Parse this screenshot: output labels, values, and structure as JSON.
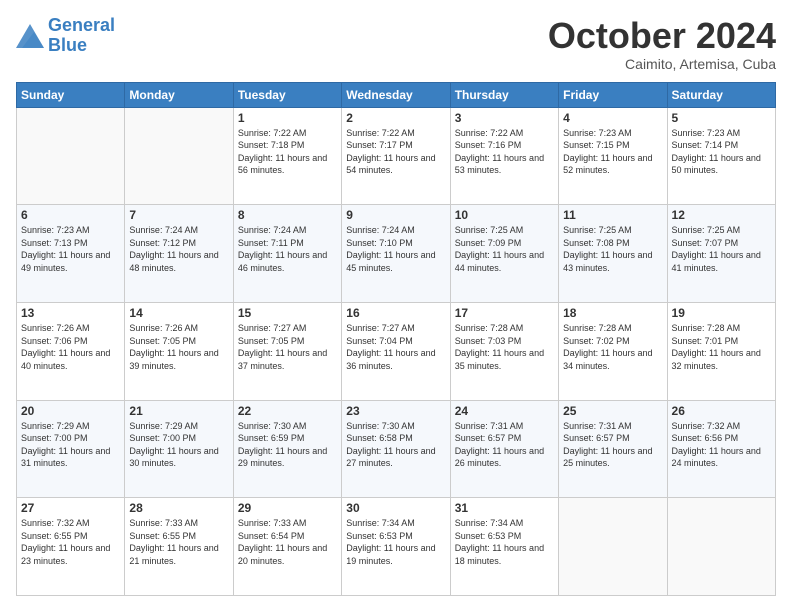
{
  "header": {
    "logo_line1": "General",
    "logo_line2": "Blue",
    "month": "October 2024",
    "location": "Caimito, Artemisa, Cuba"
  },
  "weekdays": [
    "Sunday",
    "Monday",
    "Tuesday",
    "Wednesday",
    "Thursday",
    "Friday",
    "Saturday"
  ],
  "weeks": [
    [
      {
        "day": "",
        "sunrise": "",
        "sunset": "",
        "daylight": ""
      },
      {
        "day": "",
        "sunrise": "",
        "sunset": "",
        "daylight": ""
      },
      {
        "day": "1",
        "sunrise": "Sunrise: 7:22 AM",
        "sunset": "Sunset: 7:18 PM",
        "daylight": "Daylight: 11 hours and 56 minutes."
      },
      {
        "day": "2",
        "sunrise": "Sunrise: 7:22 AM",
        "sunset": "Sunset: 7:17 PM",
        "daylight": "Daylight: 11 hours and 54 minutes."
      },
      {
        "day": "3",
        "sunrise": "Sunrise: 7:22 AM",
        "sunset": "Sunset: 7:16 PM",
        "daylight": "Daylight: 11 hours and 53 minutes."
      },
      {
        "day": "4",
        "sunrise": "Sunrise: 7:23 AM",
        "sunset": "Sunset: 7:15 PM",
        "daylight": "Daylight: 11 hours and 52 minutes."
      },
      {
        "day": "5",
        "sunrise": "Sunrise: 7:23 AM",
        "sunset": "Sunset: 7:14 PM",
        "daylight": "Daylight: 11 hours and 50 minutes."
      }
    ],
    [
      {
        "day": "6",
        "sunrise": "Sunrise: 7:23 AM",
        "sunset": "Sunset: 7:13 PM",
        "daylight": "Daylight: 11 hours and 49 minutes."
      },
      {
        "day": "7",
        "sunrise": "Sunrise: 7:24 AM",
        "sunset": "Sunset: 7:12 PM",
        "daylight": "Daylight: 11 hours and 48 minutes."
      },
      {
        "day": "8",
        "sunrise": "Sunrise: 7:24 AM",
        "sunset": "Sunset: 7:11 PM",
        "daylight": "Daylight: 11 hours and 46 minutes."
      },
      {
        "day": "9",
        "sunrise": "Sunrise: 7:24 AM",
        "sunset": "Sunset: 7:10 PM",
        "daylight": "Daylight: 11 hours and 45 minutes."
      },
      {
        "day": "10",
        "sunrise": "Sunrise: 7:25 AM",
        "sunset": "Sunset: 7:09 PM",
        "daylight": "Daylight: 11 hours and 44 minutes."
      },
      {
        "day": "11",
        "sunrise": "Sunrise: 7:25 AM",
        "sunset": "Sunset: 7:08 PM",
        "daylight": "Daylight: 11 hours and 43 minutes."
      },
      {
        "day": "12",
        "sunrise": "Sunrise: 7:25 AM",
        "sunset": "Sunset: 7:07 PM",
        "daylight": "Daylight: 11 hours and 41 minutes."
      }
    ],
    [
      {
        "day": "13",
        "sunrise": "Sunrise: 7:26 AM",
        "sunset": "Sunset: 7:06 PM",
        "daylight": "Daylight: 11 hours and 40 minutes."
      },
      {
        "day": "14",
        "sunrise": "Sunrise: 7:26 AM",
        "sunset": "Sunset: 7:05 PM",
        "daylight": "Daylight: 11 hours and 39 minutes."
      },
      {
        "day": "15",
        "sunrise": "Sunrise: 7:27 AM",
        "sunset": "Sunset: 7:05 PM",
        "daylight": "Daylight: 11 hours and 37 minutes."
      },
      {
        "day": "16",
        "sunrise": "Sunrise: 7:27 AM",
        "sunset": "Sunset: 7:04 PM",
        "daylight": "Daylight: 11 hours and 36 minutes."
      },
      {
        "day": "17",
        "sunrise": "Sunrise: 7:28 AM",
        "sunset": "Sunset: 7:03 PM",
        "daylight": "Daylight: 11 hours and 35 minutes."
      },
      {
        "day": "18",
        "sunrise": "Sunrise: 7:28 AM",
        "sunset": "Sunset: 7:02 PM",
        "daylight": "Daylight: 11 hours and 34 minutes."
      },
      {
        "day": "19",
        "sunrise": "Sunrise: 7:28 AM",
        "sunset": "Sunset: 7:01 PM",
        "daylight": "Daylight: 11 hours and 32 minutes."
      }
    ],
    [
      {
        "day": "20",
        "sunrise": "Sunrise: 7:29 AM",
        "sunset": "Sunset: 7:00 PM",
        "daylight": "Daylight: 11 hours and 31 minutes."
      },
      {
        "day": "21",
        "sunrise": "Sunrise: 7:29 AM",
        "sunset": "Sunset: 7:00 PM",
        "daylight": "Daylight: 11 hours and 30 minutes."
      },
      {
        "day": "22",
        "sunrise": "Sunrise: 7:30 AM",
        "sunset": "Sunset: 6:59 PM",
        "daylight": "Daylight: 11 hours and 29 minutes."
      },
      {
        "day": "23",
        "sunrise": "Sunrise: 7:30 AM",
        "sunset": "Sunset: 6:58 PM",
        "daylight": "Daylight: 11 hours and 27 minutes."
      },
      {
        "day": "24",
        "sunrise": "Sunrise: 7:31 AM",
        "sunset": "Sunset: 6:57 PM",
        "daylight": "Daylight: 11 hours and 26 minutes."
      },
      {
        "day": "25",
        "sunrise": "Sunrise: 7:31 AM",
        "sunset": "Sunset: 6:57 PM",
        "daylight": "Daylight: 11 hours and 25 minutes."
      },
      {
        "day": "26",
        "sunrise": "Sunrise: 7:32 AM",
        "sunset": "Sunset: 6:56 PM",
        "daylight": "Daylight: 11 hours and 24 minutes."
      }
    ],
    [
      {
        "day": "27",
        "sunrise": "Sunrise: 7:32 AM",
        "sunset": "Sunset: 6:55 PM",
        "daylight": "Daylight: 11 hours and 23 minutes."
      },
      {
        "day": "28",
        "sunrise": "Sunrise: 7:33 AM",
        "sunset": "Sunset: 6:55 PM",
        "daylight": "Daylight: 11 hours and 21 minutes."
      },
      {
        "day": "29",
        "sunrise": "Sunrise: 7:33 AM",
        "sunset": "Sunset: 6:54 PM",
        "daylight": "Daylight: 11 hours and 20 minutes."
      },
      {
        "day": "30",
        "sunrise": "Sunrise: 7:34 AM",
        "sunset": "Sunset: 6:53 PM",
        "daylight": "Daylight: 11 hours and 19 minutes."
      },
      {
        "day": "31",
        "sunrise": "Sunrise: 7:34 AM",
        "sunset": "Sunset: 6:53 PM",
        "daylight": "Daylight: 11 hours and 18 minutes."
      },
      {
        "day": "",
        "sunrise": "",
        "sunset": "",
        "daylight": ""
      },
      {
        "day": "",
        "sunrise": "",
        "sunset": "",
        "daylight": ""
      }
    ]
  ]
}
